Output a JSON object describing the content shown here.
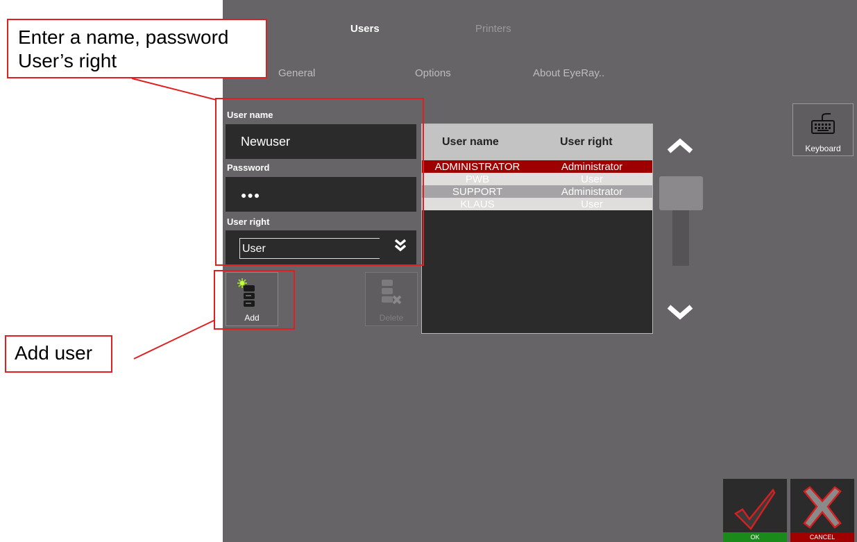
{
  "tabs_top": [
    {
      "label": "Users",
      "active": true
    },
    {
      "label": "Printers",
      "active": false
    }
  ],
  "tabs_sub": [
    "General",
    "Options",
    "About EyeRay.."
  ],
  "form": {
    "username_label": "User name",
    "username_value": "Newuser",
    "password_label": "Password",
    "password_value": "●●●",
    "right_label": "User right",
    "right_value": "User"
  },
  "buttons": {
    "add_label": "Add",
    "delete_label": "Delete",
    "keyboard_label": "Keyboard",
    "ok_label": "OK",
    "cancel_label": "CANCEL"
  },
  "table": {
    "headers": [
      "User name",
      "User right"
    ],
    "rows": [
      {
        "name": "ADMINISTRATOR",
        "right": "Administrator",
        "style": "selected"
      },
      {
        "name": "PWB",
        "right": "User",
        "style": "light"
      },
      {
        "name": "SUPPORT",
        "right": "Administrator",
        "style": "gray"
      },
      {
        "name": "KLAUS",
        "right": "User",
        "style": "light"
      }
    ]
  },
  "scroll": {
    "position": 0.2
  },
  "annotations": {
    "top": "Enter a name, password\nUser’s right",
    "bottom": "Add user"
  },
  "colors": {
    "selected_row": "#9e0000",
    "ok_bar": "#1a8a1a",
    "cancel_bar": "#a10000",
    "annotation": "#e02020"
  }
}
